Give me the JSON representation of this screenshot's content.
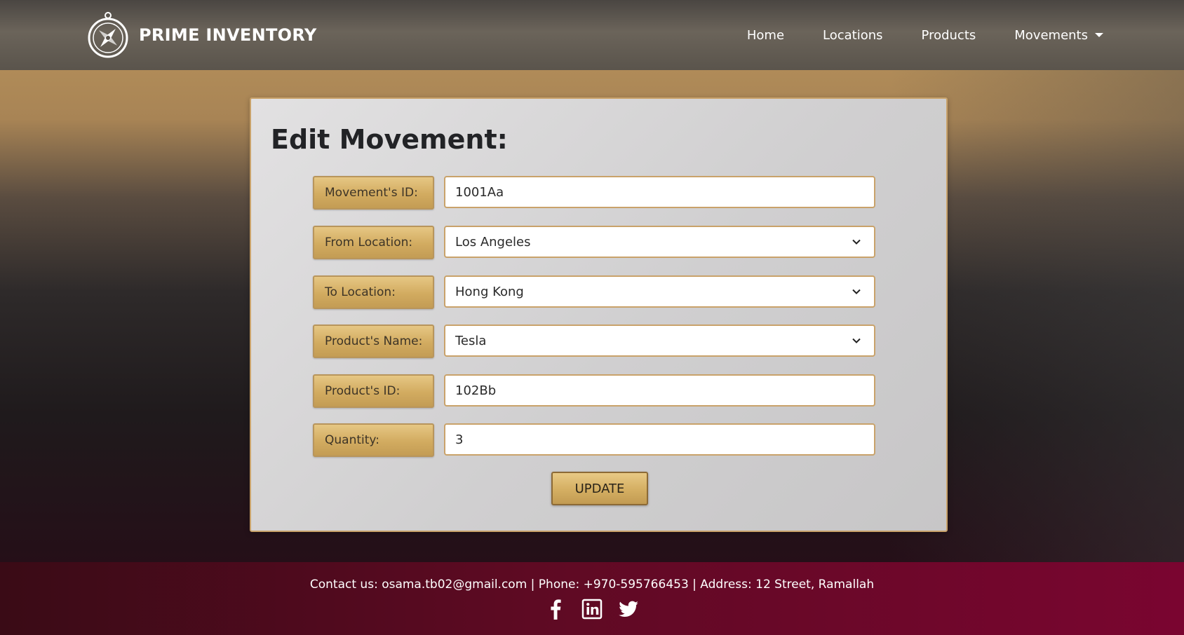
{
  "brand": {
    "name": "PRIME INVENTORY",
    "logo_icon": "compass-logo-icon"
  },
  "nav": {
    "items": [
      {
        "label": "Home"
      },
      {
        "label": "Locations"
      },
      {
        "label": "Products"
      },
      {
        "label": "Movements",
        "dropdown": true
      }
    ]
  },
  "form": {
    "title": "Edit Movement:",
    "fields": [
      {
        "label": "Movement's ID:",
        "type": "text",
        "value": "1001Aa"
      },
      {
        "label": "From Location:",
        "type": "select",
        "value": "Los Angeles"
      },
      {
        "label": "To Location:",
        "type": "select",
        "value": "Hong Kong"
      },
      {
        "label": "Product's Name:",
        "type": "select",
        "value": "Tesla"
      },
      {
        "label": "Product's ID:",
        "type": "text",
        "value": "102Bb"
      },
      {
        "label": "Quantity:",
        "type": "number",
        "value": "3"
      }
    ],
    "submit_label": "UPDATE"
  },
  "footer": {
    "contact_text": "Contact us: osama.tb02@gmail.com | Phone: +970-595766453 | Address: 12 Street, Ramallah",
    "social": [
      {
        "icon": "facebook-icon"
      },
      {
        "icon": "linkedin-icon"
      },
      {
        "icon": "twitter-icon"
      }
    ]
  },
  "colors": {
    "accent_gold": "#d4ae62",
    "card_border": "#c9a26a",
    "footer_crimson": "#7a0530"
  }
}
